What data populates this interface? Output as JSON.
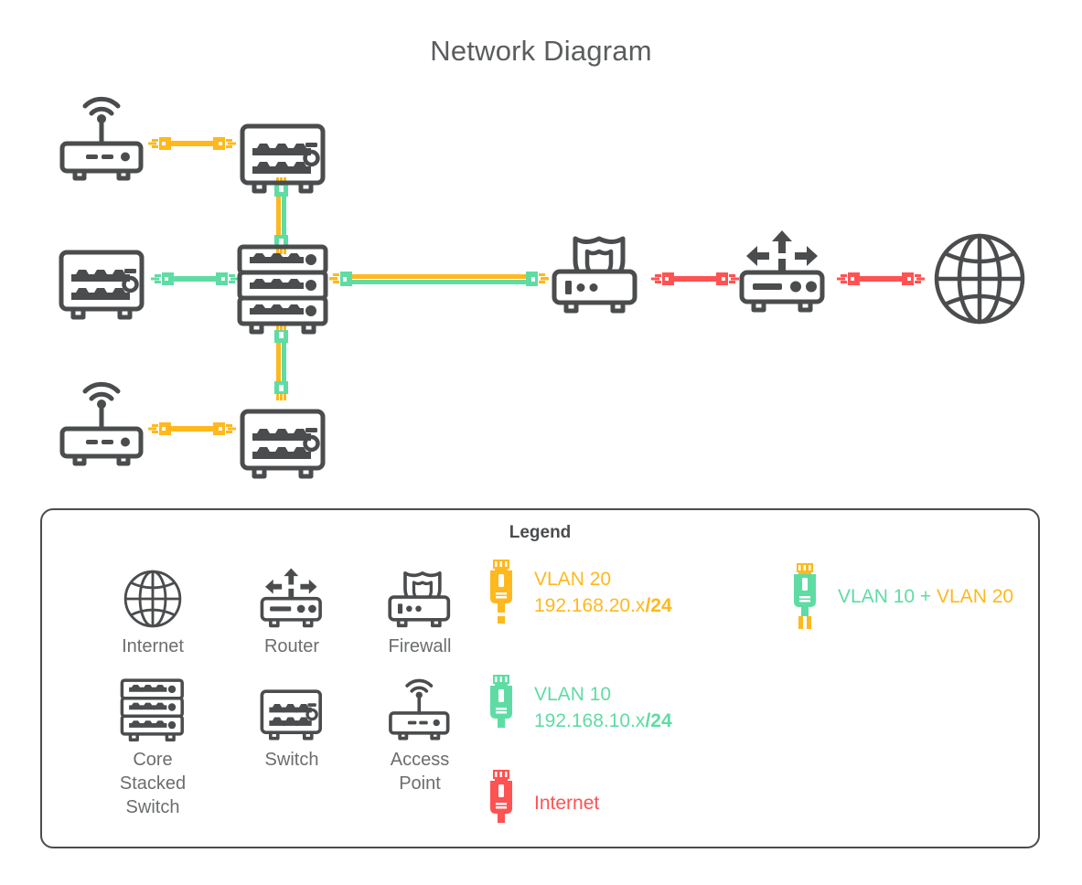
{
  "page": {
    "title": "Network Diagram"
  },
  "colors": {
    "orange": "#FFB81E",
    "green": "#5FDCA4",
    "red": "#FF5252",
    "device_stroke": "#4a4c4e",
    "text": "#6b6d6f"
  },
  "topology": {
    "nodes": [
      {
        "id": "ap-top",
        "icon": "access-point-icon",
        "row": "top"
      },
      {
        "id": "switch-top",
        "icon": "switch-icon",
        "row": "top"
      },
      {
        "id": "switch-left",
        "icon": "switch-icon",
        "row": "middle"
      },
      {
        "id": "core-switch",
        "icon": "core-stacked-switch-icon",
        "row": "middle"
      },
      {
        "id": "firewall",
        "icon": "firewall-icon",
        "row": "middle"
      },
      {
        "id": "router",
        "icon": "router-icon",
        "row": "middle"
      },
      {
        "id": "internet",
        "icon": "globe-icon",
        "row": "middle"
      },
      {
        "id": "ap-bottom",
        "icon": "access-point-icon",
        "row": "bottom"
      },
      {
        "id": "switch-bottom",
        "icon": "switch-icon",
        "row": "bottom"
      }
    ],
    "links": [
      {
        "id": "ap-top-to-switch-top",
        "type": "vlan20",
        "orientation": "horizontal"
      },
      {
        "id": "switch-top-to-core",
        "type": "vlan10-20",
        "orientation": "vertical"
      },
      {
        "id": "switch-left-to-core",
        "type": "vlan10",
        "orientation": "horizontal"
      },
      {
        "id": "core-to-firewall",
        "type": "vlan10-20",
        "orientation": "horizontal"
      },
      {
        "id": "firewall-to-router",
        "type": "internet",
        "orientation": "horizontal"
      },
      {
        "id": "router-to-internet",
        "type": "internet",
        "orientation": "horizontal"
      },
      {
        "id": "core-to-switch-bottom",
        "type": "vlan10-20",
        "orientation": "vertical"
      },
      {
        "id": "ap-bottom-to-switch-bottom",
        "type": "vlan20",
        "orientation": "horizontal"
      }
    ]
  },
  "legend": {
    "title": "Legend",
    "devices": [
      {
        "icon": "globe-icon",
        "label": "Internet"
      },
      {
        "icon": "router-icon",
        "label": "Router"
      },
      {
        "icon": "firewall-icon",
        "label": "Firewall"
      },
      {
        "icon": "core-stacked-switch-icon",
        "label": "Core\nStacked\nSwitch"
      },
      {
        "icon": "switch-icon",
        "label": "Switch"
      },
      {
        "icon": "access-point-icon",
        "label": "Access\nPoint"
      }
    ],
    "cables": [
      {
        "icon": "rj45-connector-icon",
        "variant": "orange",
        "line1": "VLAN 20",
        "line2_prefix": "192.168.20.x",
        "line2_suffix": "/24",
        "color": "#FFB81E"
      },
      {
        "icon": "rj45-connector-icon",
        "variant": "green-orange",
        "line1_a": "VLAN 10",
        "line1_plus": " + ",
        "line1_b": "VLAN 20",
        "color_a": "#5FDCA4",
        "color_b": "#FFB81E"
      },
      {
        "icon": "rj45-connector-icon",
        "variant": "green",
        "line1": "VLAN 10",
        "line2_prefix": "192.168.10.x",
        "line2_suffix": "/24",
        "color": "#5FDCA4"
      },
      {
        "icon": "rj45-connector-icon",
        "variant": "red",
        "line1": "Internet",
        "color": "#FF5252"
      }
    ]
  }
}
